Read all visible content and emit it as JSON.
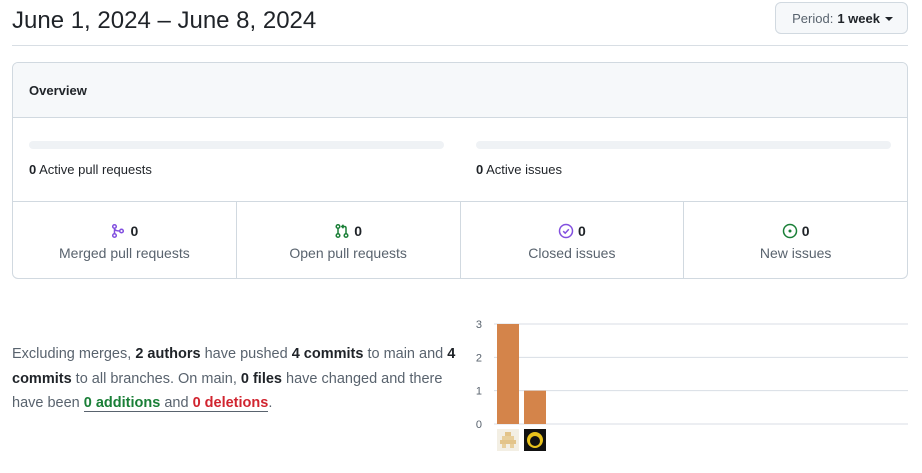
{
  "header": {
    "title": "June 1, 2024 – June 8, 2024",
    "period_label": "Period:",
    "period_value": "1 week"
  },
  "overview": {
    "heading": "Overview",
    "pull_requests": {
      "count": "0",
      "label": "Active pull requests",
      "progress": 0
    },
    "issues": {
      "count": "0",
      "label": "Active issues",
      "progress": 0
    },
    "stats": [
      {
        "count": "0",
        "label": "Merged pull requests",
        "icon": "git-merge-icon",
        "color": "#8250df"
      },
      {
        "count": "0",
        "label": "Open pull requests",
        "icon": "git-pull-request-icon",
        "color": "#1a7f37"
      },
      {
        "count": "0",
        "label": "Closed issues",
        "icon": "issue-closed-icon",
        "color": "#8250df"
      },
      {
        "count": "0",
        "label": "New issues",
        "icon": "issue-opened-icon",
        "color": "#1a7f37"
      }
    ]
  },
  "summary": {
    "t1": "Excluding merges, ",
    "authors": "2 authors",
    "t2": " have pushed ",
    "commits_main": "4 commits",
    "t3": " to main and ",
    "commits_all": "4 commits",
    "t4": " to all branches. On main, ",
    "files": "0 files",
    "t5": " have changed and there have been ",
    "additions": "0 additions",
    "t6": " and ",
    "deletions": "0 deletions",
    "t7": "."
  },
  "chart_data": {
    "type": "bar",
    "categories": [
      "author-1",
      "author-2"
    ],
    "values": [
      3,
      1
    ],
    "ylim": [
      0,
      3
    ],
    "yticks": [
      0,
      1,
      2,
      3
    ],
    "grid": true,
    "bar_color": "#d4844a"
  }
}
